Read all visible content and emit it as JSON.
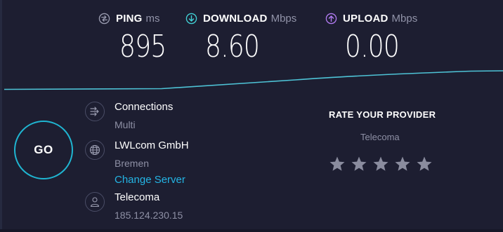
{
  "metrics": {
    "ping": {
      "label": "PING",
      "unit": "ms",
      "value": "895",
      "icon": "ping-icon",
      "icon_color": "#9a9cb0"
    },
    "download": {
      "label": "DOWNLOAD",
      "unit": "Mbps",
      "value": "8.60",
      "icon": "download-icon",
      "icon_color": "#42d3d7"
    },
    "upload": {
      "label": "UPLOAD",
      "unit": "Mbps",
      "value": "0.00",
      "icon": "upload-icon",
      "icon_color": "#b27cf2"
    }
  },
  "graph": {
    "line_color": "#4ec3d6"
  },
  "go_button": {
    "label": "GO",
    "ring_color": "#1fb5d1"
  },
  "info": {
    "connections": {
      "title": "Connections",
      "value": "Multi",
      "icon": "connections-icon"
    },
    "server": {
      "title": "LWLcom GmbH",
      "location": "Bremen",
      "change_label": "Change Server",
      "icon": "globe-icon"
    },
    "isp": {
      "title": "Telecoma",
      "ip": "185.124.230.15",
      "icon": "user-icon"
    }
  },
  "rating": {
    "title": "RATE YOUR PROVIDER",
    "provider": "Telecoma",
    "max_stars": 5,
    "selected": 0,
    "star_color": "#8a8c9e"
  },
  "colors": {
    "background": "#1d1e31",
    "link": "#24b4e4"
  }
}
